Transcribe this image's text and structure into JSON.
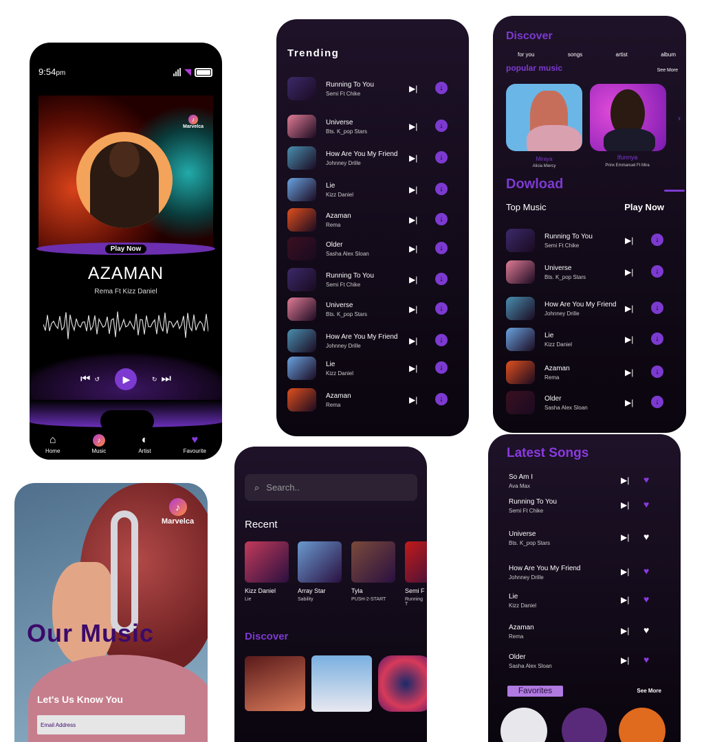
{
  "player": {
    "time": "9:54",
    "time_suffix": "pm",
    "brand": "Marvelca",
    "play_now": "Play Now",
    "song_title": "AZAMAN",
    "song_artist": "Rema Ft Kizz Daniel",
    "nav": [
      {
        "label": "Home",
        "icon": "home-icon"
      },
      {
        "label": "Music",
        "icon": "music-note-icon"
      },
      {
        "label": "Artist",
        "icon": "palette-icon"
      },
      {
        "label": "Favourite",
        "icon": "heart-icon"
      }
    ]
  },
  "trending": {
    "title": "Trending",
    "items": [
      {
        "title": "Running To You",
        "artist": "Semi Ft Chike",
        "color": "#3b2a6a"
      },
      {
        "title": "Universe",
        "artist": "Bts. K_pop Stars",
        "color": "#e07c96"
      },
      {
        "title": "How Are You My Friend",
        "artist": "Johnney Drille",
        "color": "#4a8fb0"
      },
      {
        "title": "Lie",
        "artist": "Kizz Daniel",
        "color": "#6aa3e0"
      },
      {
        "title": "Azaman",
        "artist": "Rema",
        "color": "#e0501e"
      },
      {
        "title": "Older",
        "artist": "Sasha Alex Sloan",
        "color": "#3a1020"
      },
      {
        "title": "Running To You",
        "artist": "Semi Ft Chike",
        "color": "#3b2a6a"
      },
      {
        "title": "Universe",
        "artist": "Bts. K_pop Stars",
        "color": "#e07c96"
      },
      {
        "title": "How Are You My Friend",
        "artist": "Johnney Drille",
        "color": "#4a8fb0"
      },
      {
        "title": "Lie",
        "artist": "Kizz Daniel",
        "color": "#6aa3e0"
      },
      {
        "title": "Azaman",
        "artist": "Rema",
        "color": "#e0501e"
      }
    ]
  },
  "discover": {
    "title": "Discover",
    "tabs": [
      "for you",
      "songs",
      "artist",
      "album"
    ],
    "popular": "popular music",
    "see_more": "See More",
    "cards": [
      {
        "name": "Miraya",
        "artist": "Alicia Miercy",
        "color": "#6ab6e6"
      },
      {
        "name": "Ifunnya",
        "artist": "Prinx Emmanuel Ft Mira",
        "color": "#c23ad8"
      }
    ],
    "download": "Dowload",
    "top_music": "Top Music",
    "play_now": "Play Now",
    "items": [
      {
        "title": "Running To You",
        "artist": "Semi Ft Chike",
        "color": "#3b2a6a"
      },
      {
        "title": "Universe",
        "artist": "Bts. K_pop Stars",
        "color": "#e07c96"
      },
      {
        "title": "How Are You My Friend",
        "artist": "Johnney Drille",
        "color": "#4a8fb0"
      },
      {
        "title": "Lie",
        "artist": "Kizz Daniel",
        "color": "#6aa3e0"
      },
      {
        "title": "Azaman",
        "artist": "Rema",
        "color": "#e0501e"
      },
      {
        "title": "Older",
        "artist": "Sasha Alex Sloan",
        "color": "#3a1020"
      }
    ]
  },
  "search": {
    "placeholder": "Search..",
    "recent": "Recent",
    "recents": [
      {
        "artist": "Kizz Daniel",
        "song": "Lie",
        "color": "#c23a5a"
      },
      {
        "artist": "Array Star",
        "song": "Sability",
        "color": "#6a9ad0"
      },
      {
        "artist": "Tyla",
        "song": "PUSH-2-START",
        "color": "#7a4a3a"
      },
      {
        "artist": "Semi F",
        "song": "Running T",
        "color": "#c21a1a"
      }
    ],
    "discover": "Discover"
  },
  "latest": {
    "title": "Latest Songs",
    "items": [
      {
        "title": "So Am I",
        "artist": "Ava Max",
        "liked": true
      },
      {
        "title": "Running To You",
        "artist": "Semi Ft Chike",
        "liked": true
      },
      {
        "title": "Universe",
        "artist": "Bts. K_pop Stars",
        "liked": false
      },
      {
        "title": "How Are You My Friend",
        "artist": "Johnney Drille",
        "liked": true
      },
      {
        "title": "Lie",
        "artist": "Kizz Daniel",
        "liked": true
      },
      {
        "title": "Azaman",
        "artist": "Rema",
        "liked": false
      },
      {
        "title": "Older",
        "artist": "Sasha Alex Sloan",
        "liked": true
      }
    ],
    "favorites": "Favorites",
    "see_more": "See More"
  },
  "signup": {
    "brand": "Marvelca",
    "headline": "Our Music",
    "prompt": "Let's Us Know You",
    "email_placeholder": "Email Address"
  }
}
